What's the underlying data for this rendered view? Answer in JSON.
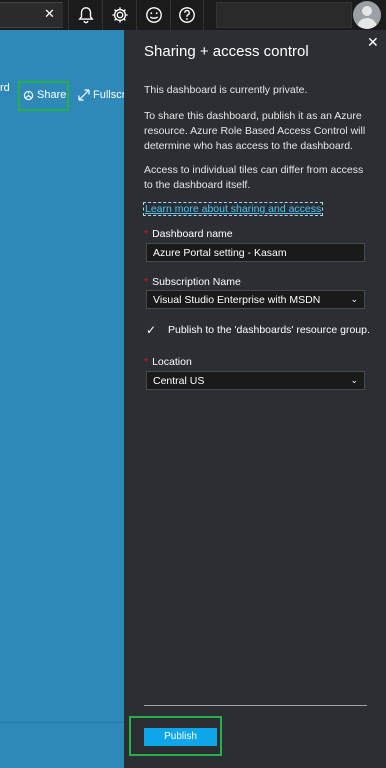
{
  "topbar": {
    "search_clear": "✕",
    "icons": [
      "bell-icon",
      "gear-icon",
      "smiley-icon",
      "help-icon"
    ]
  },
  "dashboard": {
    "partial_label": "rd",
    "share_label": "Share",
    "fullscreen_label": "Fullscre",
    "background_color": "#2f89b8"
  },
  "panel": {
    "title": "Sharing + access control",
    "close": "✕",
    "para1": "This dashboard is currently private.",
    "para2": "To share this dashboard, publish it as an Azure resource. Azure Role Based Access Control will determine who has access to the dashboard.",
    "para3": "Access to individual tiles can differ from access to the dashboard itself.",
    "learn_more": "Learn more about sharing and access",
    "dashboard_name_label": "Dashboard name",
    "dashboard_name_value": "Azure Portal setting - Kasam",
    "subscription_label": "Subscription Name",
    "subscription_value": "Visual Studio Enterprise with MSDN",
    "checkbox_label": "Publish to the 'dashboards' resource group.",
    "checkbox_checked": true,
    "location_label": "Location",
    "location_value": "Central US",
    "required_mark": "*",
    "publish_label": "Publish",
    "accent_color": "#0ea5e9",
    "highlight_color": "#27b04a"
  }
}
